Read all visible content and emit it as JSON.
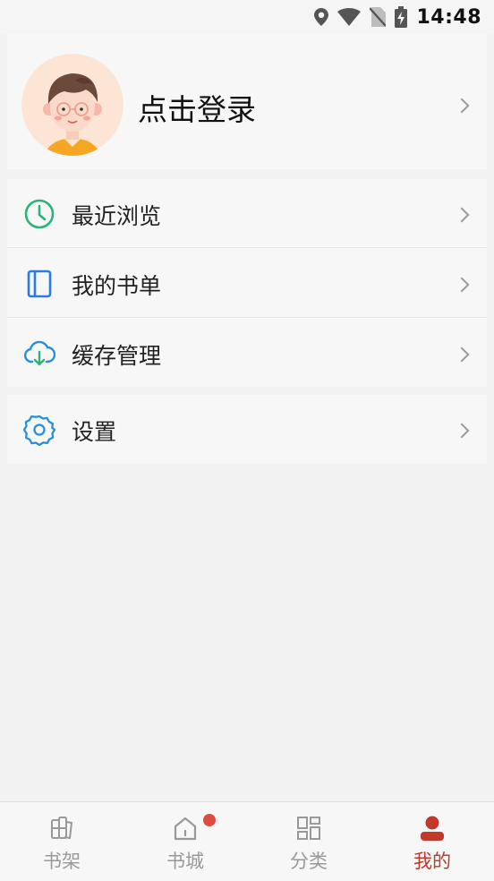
{
  "status_bar": {
    "time": "14:48",
    "icons": [
      "location-icon",
      "wifi-icon",
      "no-sim-icon",
      "battery-charging-icon"
    ]
  },
  "profile": {
    "login_label": "点击登录",
    "avatar": "avatar-illustration"
  },
  "menu": {
    "items": [
      {
        "label": "最近浏览",
        "icon": "clock-icon",
        "color": "#2db37a"
      },
      {
        "label": "我的书单",
        "icon": "booklist-icon",
        "color": "#2b7be4"
      },
      {
        "label": "缓存管理",
        "icon": "cloud-download-icon",
        "color": "#2b8ed8"
      }
    ]
  },
  "settings": {
    "label": "设置",
    "icon": "gear-icon",
    "color": "#2b8ed8"
  },
  "tabbar": {
    "active_color": "#c0392b",
    "inactive_color": "#999999",
    "badge_color": "#e04b3f",
    "tabs": [
      {
        "label": "书架",
        "icon": "bookshelf-icon"
      },
      {
        "label": "书城",
        "icon": "home-icon",
        "badge": true
      },
      {
        "label": "分类",
        "icon": "category-grid-icon"
      },
      {
        "label": "我的",
        "icon": "user-icon",
        "active": true
      }
    ]
  }
}
